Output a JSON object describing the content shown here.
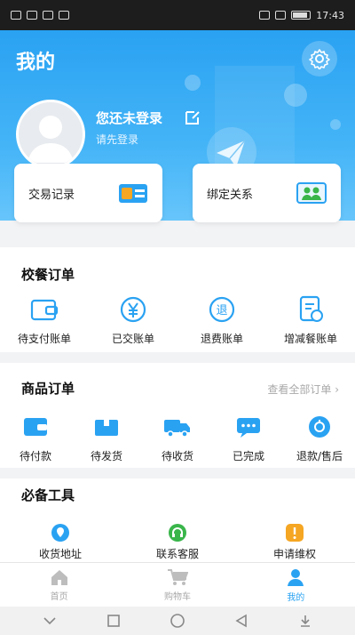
{
  "status_bar": {
    "time": "17:43"
  },
  "header": {
    "title": "我的",
    "login_prompt": "您还未登录",
    "login_sub": "请先登录"
  },
  "quick_cards": [
    {
      "label": "交易记录",
      "icon": "wallet-card-icon"
    },
    {
      "label": "绑定关系",
      "icon": "family-icon"
    }
  ],
  "school_meal_orders": {
    "title": "校餐订单",
    "items": [
      {
        "label": "待支付账单",
        "icon": "wallet-icon"
      },
      {
        "label": "已交账单",
        "icon": "yen-icon"
      },
      {
        "label": "退费账单",
        "icon": "refund-icon"
      },
      {
        "label": "增减餐账单",
        "icon": "bill-icon"
      }
    ]
  },
  "goods_orders": {
    "title": "商品订单",
    "see_all": "查看全部订单 ›",
    "items": [
      {
        "label": "待付款",
        "icon": "wallet-icon"
      },
      {
        "label": "待发货",
        "icon": "box-icon"
      },
      {
        "label": "待收货",
        "icon": "truck-icon"
      },
      {
        "label": "已完成",
        "icon": "chat-icon"
      },
      {
        "label": "退款/售后",
        "icon": "refund-circle-icon"
      }
    ]
  },
  "tools": {
    "title": "必备工具",
    "items": [
      {
        "label": "收货地址",
        "icon": "location-icon"
      },
      {
        "label": "联系客服",
        "icon": "headset-icon"
      },
      {
        "label": "申请维权",
        "icon": "alert-shield-icon"
      }
    ]
  },
  "tabbar": [
    {
      "label": "首页",
      "icon": "home-icon",
      "active": false
    },
    {
      "label": "购物车",
      "icon": "cart-icon",
      "active": false
    },
    {
      "label": "我的",
      "icon": "user-icon",
      "active": true
    }
  ],
  "colors": {
    "accent": "#2aa2f2",
    "orange": "#f5a623",
    "green": "#39b54a"
  }
}
